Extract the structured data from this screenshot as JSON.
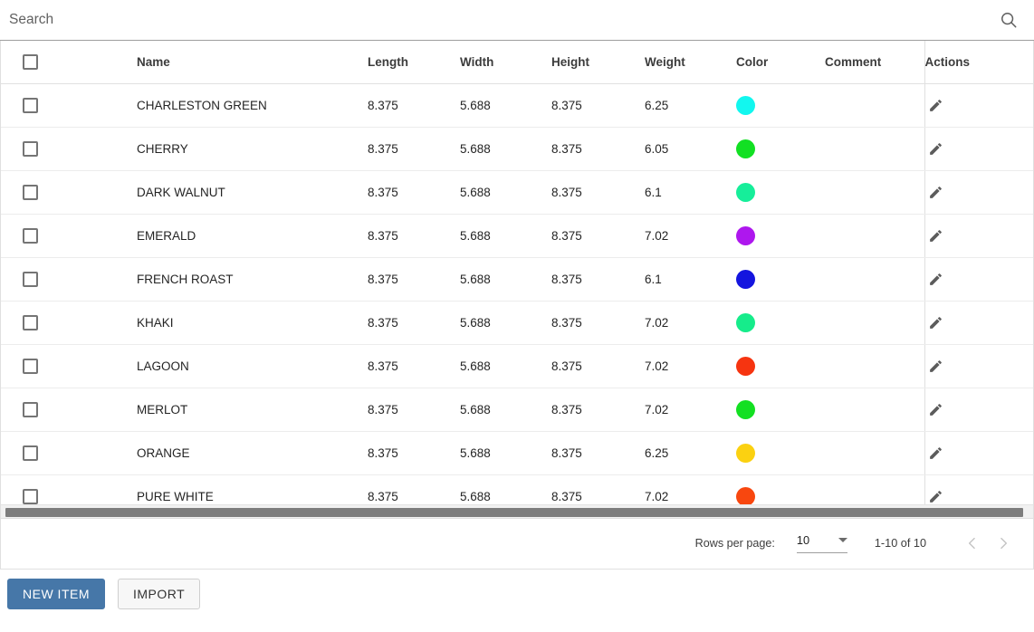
{
  "search": {
    "placeholder": "Search",
    "value": "",
    "icon": "search-icon"
  },
  "table": {
    "columns": [
      "",
      "Name",
      "Length",
      "Width",
      "Height",
      "Weight",
      "Color",
      "Comment",
      "Actions"
    ],
    "headers": {
      "name": "Name",
      "length": "Length",
      "width": "Width",
      "height": "Height",
      "weight": "Weight",
      "color": "Color",
      "comment": "Comment",
      "actions": "Actions"
    },
    "rows": [
      {
        "name": "CHARLESTON GREEN",
        "length": "8.375",
        "width": "5.688",
        "height": "8.375",
        "weight": "6.25",
        "color": "#12F7EF",
        "comment": "",
        "action_icon": "pencil-icon"
      },
      {
        "name": "CHERRY",
        "length": "8.375",
        "width": "5.688",
        "height": "8.375",
        "weight": "6.05",
        "color": "#12E023",
        "comment": "",
        "action_icon": "pencil-icon"
      },
      {
        "name": "DARK WALNUT",
        "length": "8.375",
        "width": "5.688",
        "height": "8.375",
        "weight": "6.1",
        "color": "#16EE9A",
        "comment": "",
        "action_icon": "pencil-icon"
      },
      {
        "name": "EMERALD",
        "length": "8.375",
        "width": "5.688",
        "height": "8.375",
        "weight": "7.02",
        "color": "#AE17EE",
        "comment": "",
        "action_icon": "pencil-icon"
      },
      {
        "name": "FRENCH ROAST",
        "length": "8.375",
        "width": "5.688",
        "height": "8.375",
        "weight": "6.1",
        "color": "#1415DF",
        "comment": "",
        "action_icon": "pencil-icon"
      },
      {
        "name": "KHAKI",
        "length": "8.375",
        "width": "5.688",
        "height": "8.375",
        "weight": "7.02",
        "color": "#16EC8B",
        "comment": "",
        "action_icon": "pencil-icon"
      },
      {
        "name": "LAGOON",
        "length": "8.375",
        "width": "5.688",
        "height": "8.375",
        "weight": "7.02",
        "color": "#F63410",
        "comment": "",
        "action_icon": "pencil-icon"
      },
      {
        "name": "MERLOT",
        "length": "8.375",
        "width": "5.688",
        "height": "8.375",
        "weight": "7.02",
        "color": "#13E022",
        "comment": "",
        "action_icon": "pencil-icon"
      },
      {
        "name": "ORANGE",
        "length": "8.375",
        "width": "5.688",
        "height": "8.375",
        "weight": "6.25",
        "color": "#FBD111",
        "comment": "",
        "action_icon": "pencil-icon"
      },
      {
        "name": "PURE WHITE",
        "length": "8.375",
        "width": "5.688",
        "height": "8.375",
        "weight": "7.02",
        "color": "#F8470F",
        "comment": "",
        "action_icon": "pencil-icon"
      }
    ]
  },
  "paginator": {
    "rows_per_page_label": "Rows per page:",
    "rows_per_page_value": "10",
    "range_label": "1-10 of 10",
    "prev_icon": "chevron-left-icon",
    "next_icon": "chevron-right-icon",
    "prev_disabled": true,
    "next_disabled": true
  },
  "footer": {
    "new_item_label": "NEW ITEM",
    "import_label": "IMPORT",
    "primary_color": "#4677a8"
  }
}
